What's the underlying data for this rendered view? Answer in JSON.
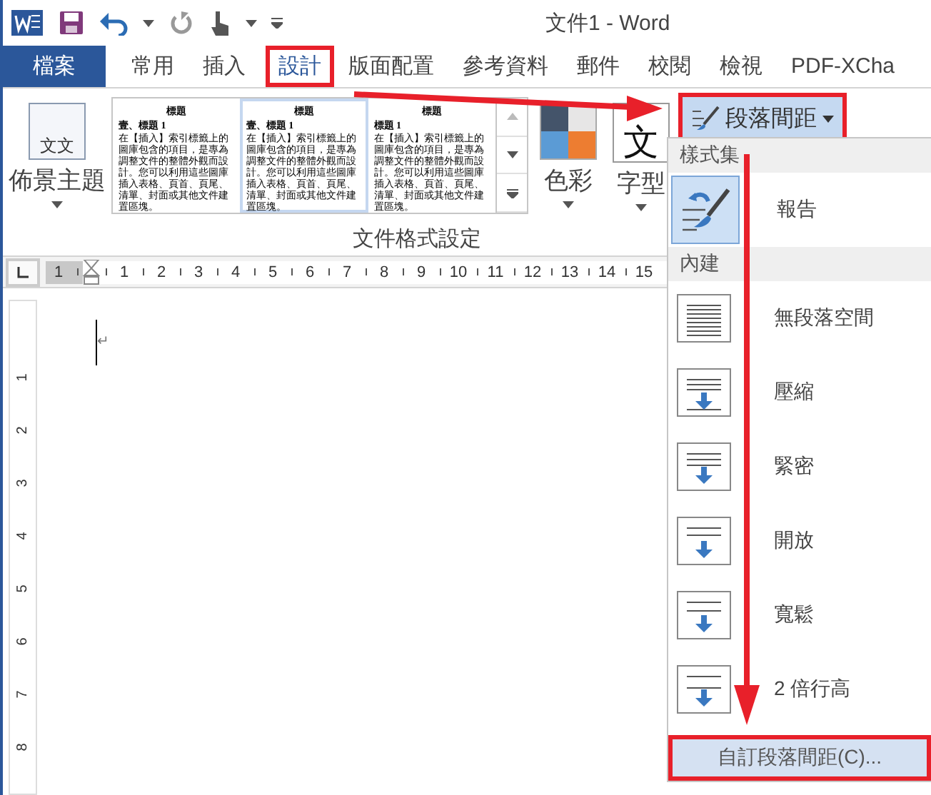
{
  "window": {
    "title": "文件1 - Word"
  },
  "tabs": [
    {
      "label": "檔案",
      "kind": "file",
      "selected": false,
      "highlighted": false
    },
    {
      "label": "常用",
      "kind": "tab",
      "selected": false,
      "highlighted": false
    },
    {
      "label": "插入",
      "kind": "tab",
      "selected": false,
      "highlighted": false
    },
    {
      "label": "設計",
      "kind": "tab",
      "selected": true,
      "highlighted": true
    },
    {
      "label": "版面配置",
      "kind": "tab",
      "selected": false,
      "highlighted": false
    },
    {
      "label": "參考資料",
      "kind": "tab",
      "selected": false,
      "highlighted": false
    },
    {
      "label": "郵件",
      "kind": "tab",
      "selected": false,
      "highlighted": false
    },
    {
      "label": "校閱",
      "kind": "tab",
      "selected": false,
      "highlighted": false
    },
    {
      "label": "檢視",
      "kind": "tab",
      "selected": false,
      "highlighted": false
    },
    {
      "label": "PDF-XCha",
      "kind": "tab",
      "selected": false,
      "highlighted": false
    }
  ],
  "ribbon": {
    "themes_button": {
      "label": "佈景主題",
      "glyph": "文文"
    },
    "gallery": [
      {
        "title": "標題",
        "heading": "壹、標題 1",
        "body": "在【插入】索引標籤上的圖庫包含的項目，是專為調整文件的整體外觀而設計。您可以利用這些圖庫插入表格、頁首、頁尾、清單、封面或其他文件建置區塊。",
        "selected": false
      },
      {
        "title": "標題",
        "heading": "壹、標題 1",
        "body": "在【插入】索引標籤上的圖庫包含的項目，是專為調整文件的整體外觀而設計。您可以利用這些圖庫插入表格、頁首、頁尾、清單、封面或其他文件建置區塊。",
        "selected": true
      },
      {
        "title": "標題",
        "heading": "標題 1",
        "body": "在【插入】索引標籤上的圖庫包含的項目，是專為調整文件的整體外觀而設計。您可以利用這些圖庫插入表格、頁首、頁尾、清單、封面或其他文件建置區塊。",
        "selected": false
      }
    ],
    "colors_button": {
      "label": "色彩",
      "swatches": [
        {
          "color": "#44546a"
        },
        {
          "color": "#e7e6e6"
        },
        {
          "color": "#5b9bd5"
        },
        {
          "color": "#ed7d31"
        }
      ]
    },
    "fonts_button": {
      "label": "字型",
      "glyph": "文"
    },
    "spacing_button": {
      "label": "段落間距",
      "highlighted": true
    },
    "group_label": "文件格式設定"
  },
  "ruler": {
    "ticks": [
      "1",
      "1",
      "2",
      "3",
      "4",
      "5",
      "6",
      "7",
      "8",
      "9",
      "10",
      "11",
      "12",
      "13",
      "14",
      "15"
    ]
  },
  "vertical_ruler": {
    "ticks": [
      "1",
      "2",
      "3",
      "4",
      "5",
      "6",
      "7",
      "8"
    ]
  },
  "document": {
    "paragraph_mark": "↵"
  },
  "spacing_menu": {
    "sections": [
      {
        "header": "樣式集",
        "items": [
          {
            "label": "報告",
            "kind": "custom",
            "selected": true
          }
        ]
      },
      {
        "header": "內建",
        "items": [
          {
            "label": "無段落空間",
            "kind": "none",
            "selected": false
          },
          {
            "label": "壓縮",
            "kind": "compact",
            "selected": false
          },
          {
            "label": "緊密",
            "kind": "tight",
            "selected": false
          },
          {
            "label": "開放",
            "kind": "open",
            "selected": false
          },
          {
            "label": "寬鬆",
            "kind": "relaxed",
            "selected": false
          },
          {
            "label": "2 倍行高",
            "kind": "double",
            "selected": false
          }
        ]
      }
    ],
    "footer": {
      "label": "自訂段落間距(C)...",
      "highlighted": true
    }
  }
}
